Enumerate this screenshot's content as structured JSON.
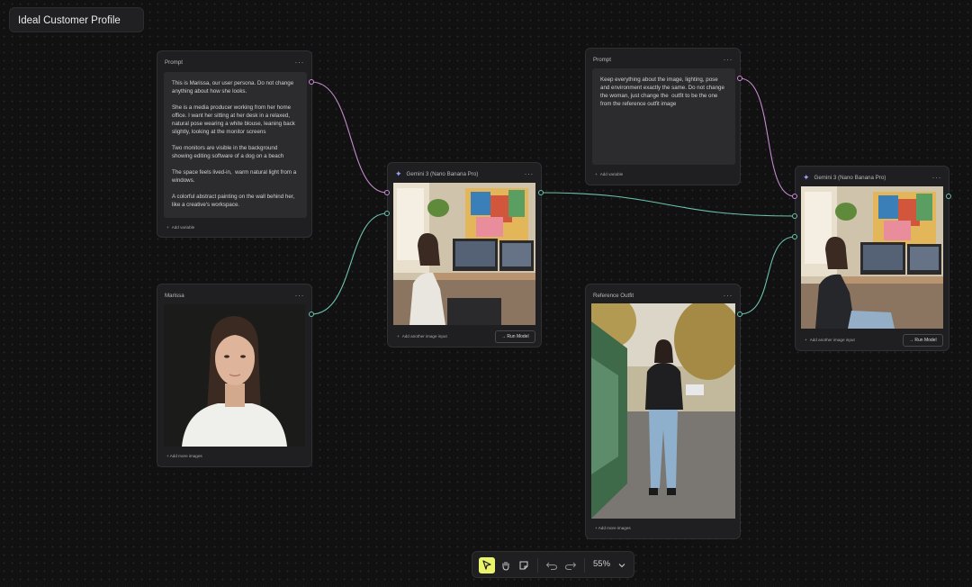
{
  "board": {
    "title": "Ideal Customer Profile"
  },
  "nodes": {
    "prompt1": {
      "header": "Prompt",
      "text": "This is Marissa, our user persona. Do not change anything about how she looks.\n\nShe is a media producer working from her home office. I want her sitting at her desk in a relaxed, natural pose wearing a white blouse, leaning back slightly, looking at the monitor screens\n\nTwo monitors are visible in the background showing editing software of a dog on a beach\n\nThe space feels lived-in,  warm natural light from a windows.\n\nA colorful abstract painting on the wall behind her, like a creative's workspace.",
      "add_label": "Add variable"
    },
    "marissa": {
      "header": "Marissa",
      "add_label": "+ Add more images"
    },
    "gemini1": {
      "header": "Gemini 3 (Nano Banana Pro)",
      "add_label": "Add another image input",
      "run_label": "Run Model"
    },
    "prompt2": {
      "header": "Prompt",
      "text": "Keep everything about the image, lighting, pose and environment exactly the same. Do not change the woman, just change the  outfit to be the one from the reference outfit image",
      "add_label": "Add variable"
    },
    "reference": {
      "header": "Reference Outfit",
      "add_label": "+ Add more images"
    },
    "gemini2": {
      "header": "Gemini 3 (Nano Banana Pro)",
      "add_label": "Add another image input",
      "run_label": "Run Model"
    }
  },
  "menu_glyph": "···",
  "toolbar": {
    "zoom": "55%",
    "tools": [
      "select-icon",
      "hand-icon",
      "sticky-note-icon",
      "undo-icon",
      "redo-icon",
      "chevron-down-icon"
    ]
  },
  "colors": {
    "accent_pink": "#d08ad9",
    "accent_teal": "#6cc3ad",
    "active_tool": "#e9f36b",
    "node_bg": "#1f1f21",
    "canvas_bg": "#111112"
  }
}
